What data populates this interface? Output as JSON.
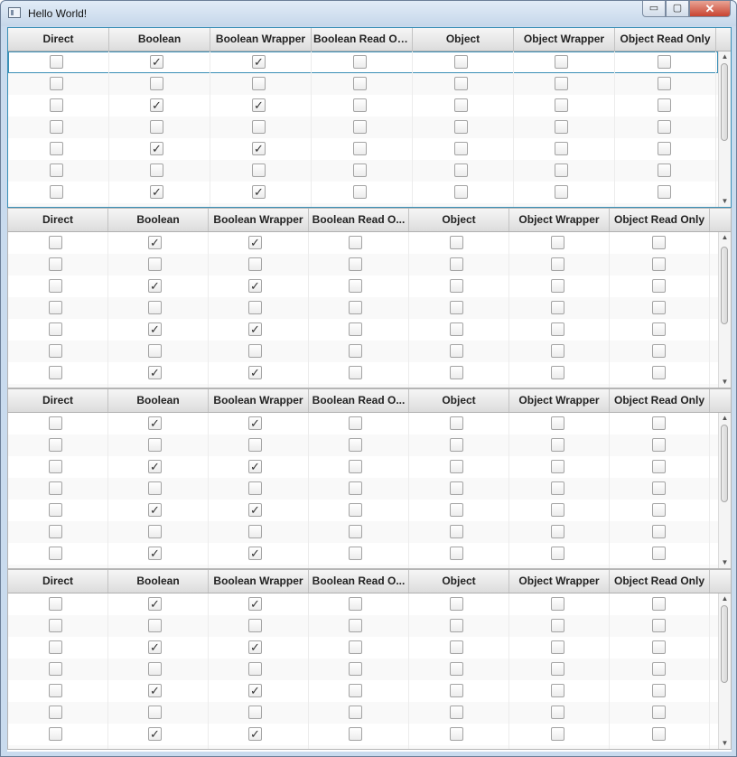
{
  "window": {
    "title": "Hello World!",
    "controls": {
      "minimize": "▭",
      "maximize": "▢",
      "close": "✕"
    },
    "icon": "window-app-icon"
  },
  "tables": [
    {
      "columns": [
        "Direct",
        "Boolean",
        "Boolean Wrapper",
        "Boolean Read Only",
        "Object",
        "Object Wrapper",
        "Object Read Only"
      ],
      "rows": [
        [
          false,
          true,
          true,
          false,
          false,
          false,
          false
        ],
        [
          false,
          false,
          false,
          false,
          false,
          false,
          false
        ],
        [
          false,
          true,
          true,
          false,
          false,
          false,
          false
        ],
        [
          false,
          false,
          false,
          false,
          false,
          false,
          false
        ],
        [
          false,
          true,
          true,
          false,
          false,
          false,
          false
        ],
        [
          false,
          false,
          false,
          false,
          false,
          false,
          false
        ],
        [
          false,
          true,
          true,
          false,
          false,
          false,
          false
        ],
        [
          false,
          false,
          false,
          false,
          false,
          false,
          false
        ]
      ]
    },
    {
      "columns": [
        "Direct",
        "Boolean",
        "Boolean Wrapper",
        "Boolean Read O...",
        "Object",
        "Object Wrapper",
        "Object Read Only"
      ],
      "rows": [
        [
          false,
          true,
          true,
          false,
          false,
          false,
          false
        ],
        [
          false,
          false,
          false,
          false,
          false,
          false,
          false
        ],
        [
          false,
          true,
          true,
          false,
          false,
          false,
          false
        ],
        [
          false,
          false,
          false,
          false,
          false,
          false,
          false
        ],
        [
          false,
          true,
          true,
          false,
          false,
          false,
          false
        ],
        [
          false,
          false,
          false,
          false,
          false,
          false,
          false
        ],
        [
          false,
          true,
          true,
          false,
          false,
          false,
          false
        ],
        [
          false,
          false,
          false,
          false,
          false,
          false,
          false
        ]
      ]
    },
    {
      "columns": [
        "Direct",
        "Boolean",
        "Boolean Wrapper",
        "Boolean Read O...",
        "Object",
        "Object Wrapper",
        "Object Read Only"
      ],
      "rows": [
        [
          false,
          true,
          true,
          false,
          false,
          false,
          false
        ],
        [
          false,
          false,
          false,
          false,
          false,
          false,
          false
        ],
        [
          false,
          true,
          true,
          false,
          false,
          false,
          false
        ],
        [
          false,
          false,
          false,
          false,
          false,
          false,
          false
        ],
        [
          false,
          true,
          true,
          false,
          false,
          false,
          false
        ],
        [
          false,
          false,
          false,
          false,
          false,
          false,
          false
        ],
        [
          false,
          true,
          true,
          false,
          false,
          false,
          false
        ],
        [
          false,
          false,
          false,
          false,
          false,
          false,
          false
        ]
      ]
    },
    {
      "columns": [
        "Direct",
        "Boolean",
        "Boolean Wrapper",
        "Boolean Read O...",
        "Object",
        "Object Wrapper",
        "Object Read Only"
      ],
      "rows": [
        [
          false,
          true,
          true,
          false,
          false,
          false,
          false
        ],
        [
          false,
          false,
          false,
          false,
          false,
          false,
          false
        ],
        [
          false,
          true,
          true,
          false,
          false,
          false,
          false
        ],
        [
          false,
          false,
          false,
          false,
          false,
          false,
          false
        ],
        [
          false,
          true,
          true,
          false,
          false,
          false,
          false
        ],
        [
          false,
          false,
          false,
          false,
          false,
          false,
          false
        ],
        [
          false,
          true,
          true,
          false,
          false,
          false,
          false
        ],
        [
          false,
          false,
          false,
          false,
          false,
          false,
          false
        ]
      ]
    }
  ],
  "state": {
    "focused_table": 0,
    "selected_row": 0
  },
  "check_glyph": "✓",
  "scroll": {
    "up": "▲",
    "down": "▼"
  }
}
